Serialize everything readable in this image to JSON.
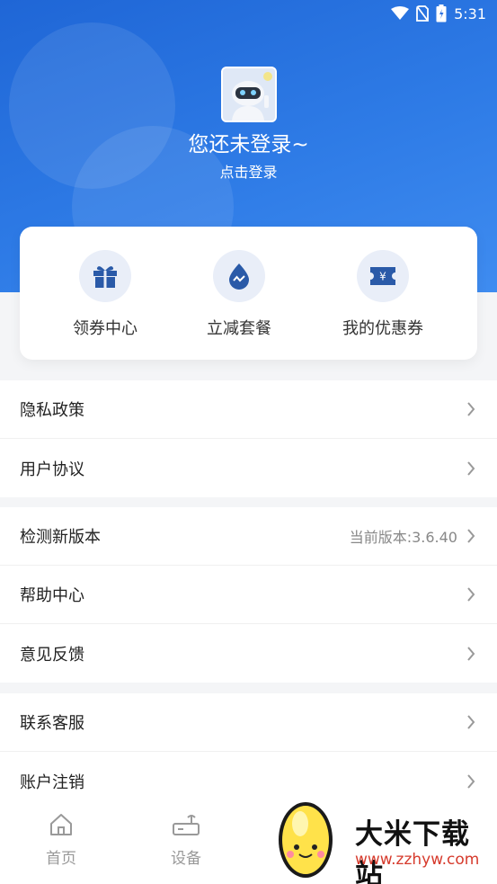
{
  "status_bar": {
    "time": "5:31",
    "icons": [
      "wifi-icon",
      "no-sim-icon",
      "battery-icon"
    ]
  },
  "profile": {
    "title": "您还未登录~",
    "subtitle": "点击登录",
    "avatar": "robot-avatar"
  },
  "quick_actions": [
    {
      "label": "领券中心",
      "icon": "gift-icon"
    },
    {
      "label": "立减套餐",
      "icon": "drop-icon"
    },
    {
      "label": "我的优惠券",
      "icon": "coupon-yen-icon"
    }
  ],
  "menu_group_1": [
    {
      "label": "隐私政策"
    },
    {
      "label": "用户协议"
    }
  ],
  "menu_group_2": [
    {
      "label": "检测新版本",
      "value": "当前版本:3.6.40"
    },
    {
      "label": "帮助中心"
    },
    {
      "label": "意见反馈"
    }
  ],
  "menu_group_3": [
    {
      "label": "联系客服"
    },
    {
      "label": "账户注销"
    }
  ],
  "tabbar": [
    {
      "label": "首页",
      "icon": "home-icon"
    },
    {
      "label": "设备",
      "icon": "router-icon"
    }
  ],
  "watermark": {
    "name": "大米下载站",
    "url": "www.zzhyw.com"
  },
  "colors": {
    "primary": "#2c72e0",
    "icon_blue": "#2a5aa8",
    "icon_bg": "#e9eef8",
    "watermark_red": "#d63a2c"
  }
}
